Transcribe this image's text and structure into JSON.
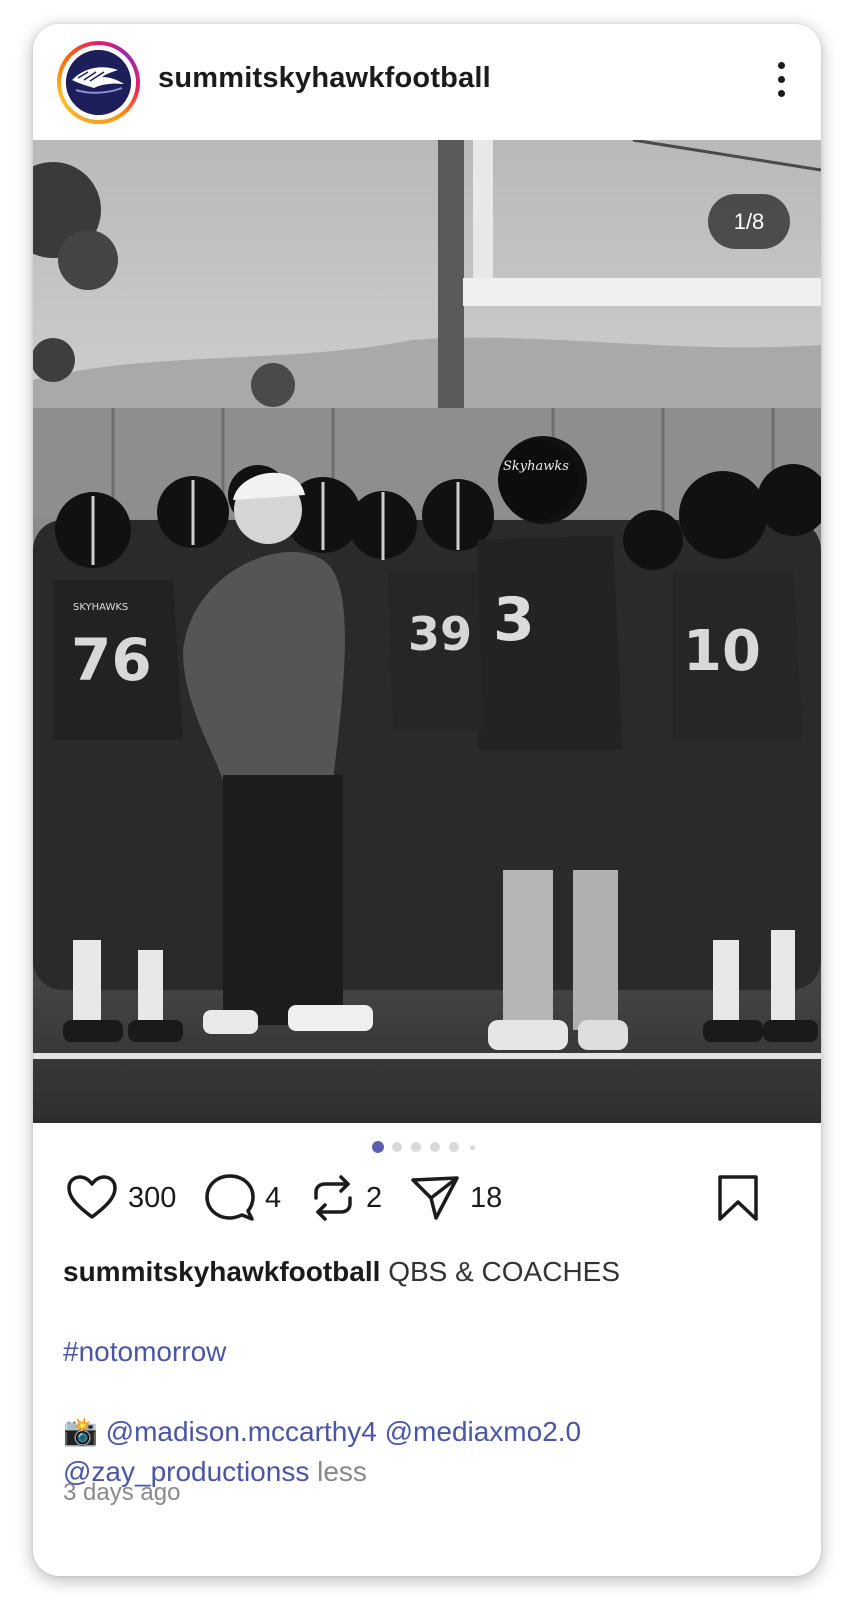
{
  "post": {
    "username": "summitskyhawkfootball",
    "image_counter": "1/8",
    "carousel": {
      "total_dots": 6,
      "active_index": 0
    },
    "likes": "300",
    "comments": "4",
    "reposts": "2",
    "shares": "18",
    "caption_user": "summitskyhawkfootball",
    "caption_text": "QBS & COACHES",
    "hashtag": "#notomorrow",
    "camera_emoji": "📸",
    "mention_1": "@madison.mccarthy4",
    "mention_2": "@mediaxmo2.0",
    "mention_3": "@zay_productionss",
    "less_label": "less",
    "timestamp": "3 days ago"
  },
  "photo_jersey_text": {
    "team_name": "SKYHAWKS",
    "helmet_script": "Skyhawks",
    "number_left": "76",
    "number_center": "3",
    "number_mid": "39",
    "number_right": "10"
  },
  "colors": {
    "accent_blue": "#4a55a8",
    "active_dot": "#5b5fb0",
    "inactive_dot": "#d9d9d9",
    "text_dark": "#1b1b1b",
    "text_muted": "#8a8a8a"
  },
  "icons": [
    "more-vertical-icon",
    "heart-icon",
    "comment-icon",
    "repost-icon",
    "send-icon",
    "bookmark-icon"
  ]
}
